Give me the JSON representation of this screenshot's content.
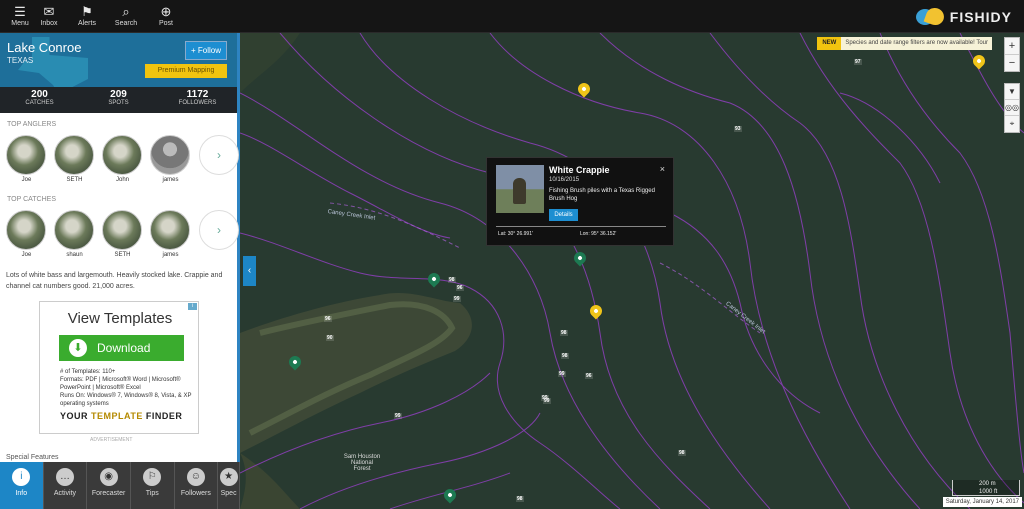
{
  "topnav": {
    "items": [
      {
        "label": "Menu",
        "icon": "menu-icon",
        "glyph": "☰"
      },
      {
        "label": "Inbox",
        "icon": "inbox-icon",
        "glyph": "✉"
      },
      {
        "label": "Alerts",
        "icon": "flag-icon",
        "glyph": "⚑"
      },
      {
        "label": "Search",
        "icon": "search-icon",
        "glyph": "⌕"
      },
      {
        "label": "Post",
        "icon": "plus-icon",
        "glyph": "⊕"
      }
    ],
    "brand": "FISHIDY"
  },
  "lake": {
    "name": "Lake Conroe",
    "state": "TEXAS",
    "follow_label": "+ Follow",
    "premium_label": "Premium Mapping",
    "stats": [
      {
        "value": "200",
        "label": "CATCHES"
      },
      {
        "value": "209",
        "label": "SPOTS"
      },
      {
        "value": "1172",
        "label": "FOLLOWERS"
      }
    ]
  },
  "top_anglers": {
    "title": "TOP ANGLERS",
    "people": [
      {
        "name": "Joe"
      },
      {
        "name": "SETH"
      },
      {
        "name": "John"
      },
      {
        "name": "james"
      }
    ]
  },
  "top_catches": {
    "title": "TOP CATCHES",
    "people": [
      {
        "name": "Joe"
      },
      {
        "name": "shaun"
      },
      {
        "name": "SETH"
      },
      {
        "name": "james"
      }
    ]
  },
  "more_glyph": "›",
  "description": "Lots of white bass and largemouth. Heavily stocked lake. Crappie and channel cat numbers good. 21,000 acres.",
  "ad": {
    "title": "View Templates",
    "button": "Download",
    "lines": [
      "# of Templates: 110+",
      "Formats: PDF | Microsoft® Word | Microsoft® PowerPoint | Microsoft® Excel",
      "Runs On: Windows® 7, Windows® 8, Vista, & XP operating systems"
    ],
    "brand_a": "YOUR ",
    "brand_b": "TEMPLATE",
    "brand_c": " FINDER",
    "label": "ADVERTISEMENT"
  },
  "special_features": "Special Features",
  "tabs": [
    {
      "label": "Info",
      "glyph": "i",
      "icon": "info-icon",
      "active": true
    },
    {
      "label": "Activity",
      "glyph": "…",
      "icon": "chat-icon",
      "active": false
    },
    {
      "label": "Forecaster",
      "glyph": "◉",
      "icon": "eye-icon",
      "active": false
    },
    {
      "label": "Tips",
      "glyph": "⚐",
      "icon": "tips-icon",
      "active": false
    },
    {
      "label": "Followers",
      "glyph": "☺",
      "icon": "followers-icon",
      "active": false
    },
    {
      "label": "Spec",
      "glyph": "★",
      "icon": "species-icon",
      "active": false
    }
  ],
  "map": {
    "notice_new": "NEW",
    "notice_text": "Species and date range filters are now available! Tour",
    "zoom_in": "+",
    "zoom_out": "−",
    "scale_top": "200 m",
    "scale_bottom": "1000 ft",
    "date": "Saturday, January 14, 2017",
    "labels": [
      {
        "text": "Caney Creek Inlet"
      },
      {
        "text": "Caney Creek Inlet"
      },
      {
        "text": "Sam Houston National Forest"
      }
    ]
  },
  "popup": {
    "title": "White Crappie",
    "date": "10/16/2015",
    "description": "Fishing Brush piles with a Texas Rigged Brush Hog",
    "details_label": "Details",
    "close_glyph": "×",
    "lat": "Lat: 30° 26.991'",
    "lon": "Lon: 95° 36.152'"
  },
  "colors": {
    "accent": "#1d86c6",
    "premium": "#f1c40f",
    "map_water": "#283a30",
    "contour": "#8f3fbd",
    "pin_yellow": "#f0c419",
    "pin_green": "#1d7a52"
  }
}
